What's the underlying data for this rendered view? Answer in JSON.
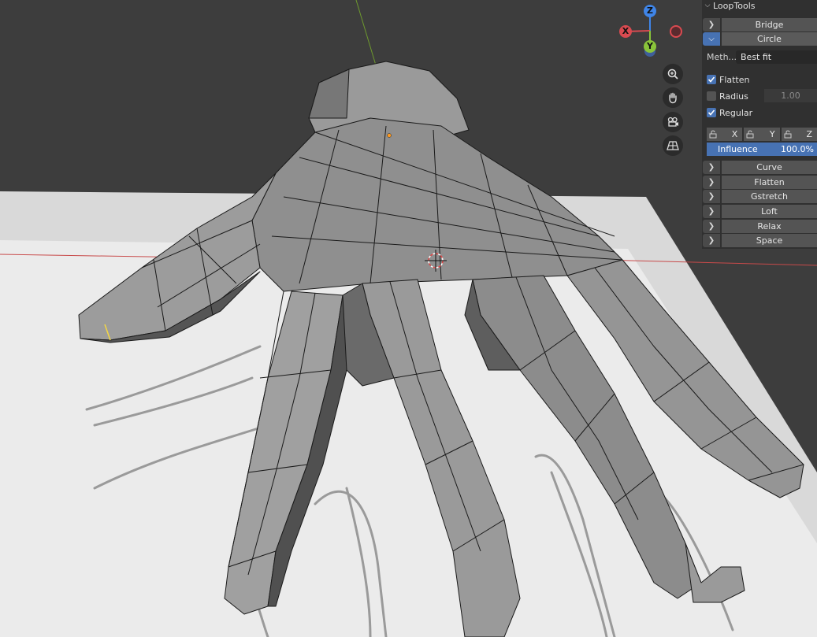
{
  "gizmo": {
    "x_label": "X",
    "y_label": "Y",
    "z_label": "Z",
    "colors": {
      "x": "#d94a50",
      "y": "#8ac43a",
      "z": "#3f85e8"
    }
  },
  "nav_buttons": [
    "zoom-icon",
    "pan-hand-icon",
    "camera-icon",
    "grid-perspective-icon"
  ],
  "panel": {
    "title": "LoopTools",
    "bridge_label": "Bridge",
    "circle_label": "Circle",
    "circle": {
      "method_label": "Meth...",
      "method_value": "Best fit",
      "flatten_label": "Flatten",
      "radius_label": "Radius",
      "radius_value": "1.00",
      "regular_label": "Regular",
      "lock_x": "X",
      "lock_y": "Y",
      "lock_z": "Z",
      "influence_label": "Influence",
      "influence_value": "100.0%"
    },
    "curve_label": "Curve",
    "flatten_tool_label": "Flatten",
    "gstretch_label": "Gstretch",
    "loft_label": "Loft",
    "relax_label": "Relax",
    "space_label": "Space"
  },
  "colors": {
    "viewport_bg": "#3d3d3d",
    "accent": "#4772b3",
    "mesh_face": "#8f8f8f",
    "mesh_edge": "#1a1a1a"
  }
}
